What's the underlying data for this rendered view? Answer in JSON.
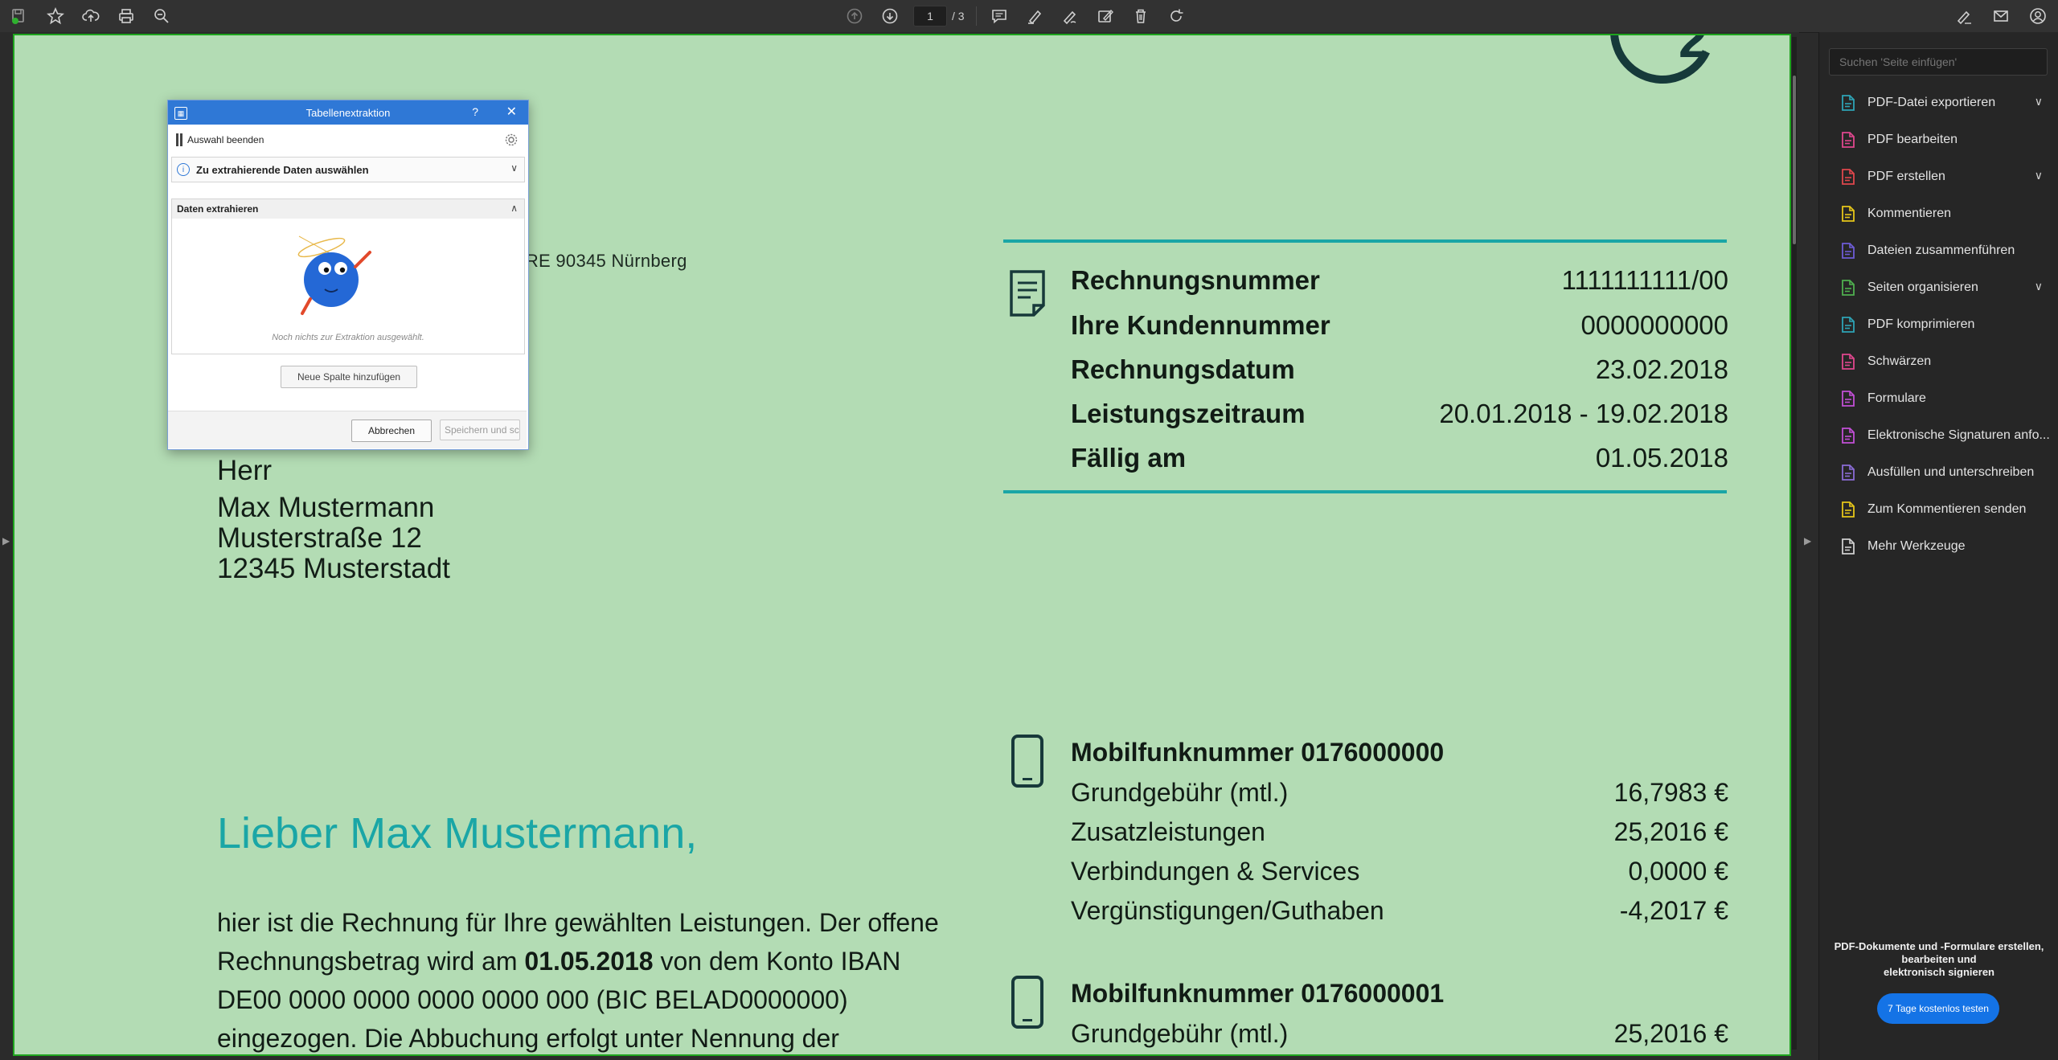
{
  "toolbar": {
    "page_current": "1",
    "page_total": "/ 3"
  },
  "document": {
    "logo_fragment": "2",
    "sender_line": "G  RE  90345 Nürnberg",
    "address": [
      "Herr",
      "Max Mustermann",
      "Musterstraße 12",
      "12345 Musterstadt"
    ],
    "info_rows": [
      {
        "key": "Rechnungsnummer",
        "value": "1111111111/00"
      },
      {
        "key": "Ihre Kundennummer",
        "value": "0000000000"
      },
      {
        "key": "Rechnungsdatum",
        "value": "23.02.2018"
      },
      {
        "key": "Leistungszeitraum",
        "value": "20.01.2018 - 19.02.2018"
      },
      {
        "key": "Fällig am",
        "value": "01.05.2018"
      }
    ],
    "mobile1": {
      "heading": "Mobilfunknummer 0176000000",
      "rows": [
        {
          "key": "Grundgebühr (mtl.)",
          "value": "16,7983 €"
        },
        {
          "key": "Zusatzleistungen",
          "value": "25,2016 €"
        },
        {
          "key": "Verbindungen & Services",
          "value": "0,0000 €"
        },
        {
          "key": "Vergünstigungen/Guthaben",
          "value": "-4,2017 €"
        }
      ]
    },
    "mobile2": {
      "heading": "Mobilfunknummer 0176000001",
      "rows": [
        {
          "key": "Grundgebühr (mtl.)",
          "value": "25,2016 €"
        }
      ]
    },
    "greeting": "Lieber Max Mustermann,",
    "body": {
      "line1": "hier ist die Rechnung für Ihre gewählten Leistungen. Der offene",
      "line2_a": "Rechnungsbetrag wird am ",
      "line2_b": "01.05.2018",
      "line2_c": " von dem Konto IBAN",
      "line3": "DE00 0000 0000 0000 0000 000 (BIC BELAD0000000)",
      "line4": "eingezogen. Die Abbuchung erfolgt unter Nennung der"
    }
  },
  "dialog": {
    "title": "Tabellenextraktion",
    "help": "?",
    "close": "✕",
    "stop_selection": "Auswahl beenden",
    "select_data": "Zu extrahierende Daten auswählen",
    "extract_header": "Daten extrahieren",
    "empty_message": "Noch nichts zur Extraktion ausgewählt.",
    "add_column": "Neue Spalte hinzufügen",
    "cancel": "Abbrechen",
    "save": "Speichern und sc"
  },
  "right_pane": {
    "search_placeholder": "Suchen 'Seite einfügen'",
    "tools": [
      {
        "label": "PDF-Datei exportieren",
        "icon": "export-pdf-icon",
        "color": "#2ea4b6",
        "expand": true
      },
      {
        "label": "PDF bearbeiten",
        "icon": "edit-pdf-icon",
        "color": "#e0478e",
        "expand": false
      },
      {
        "label": "PDF erstellen",
        "icon": "create-pdf-icon",
        "color": "#e0474c",
        "expand": true
      },
      {
        "label": "Kommentieren",
        "icon": "comment-icon",
        "color": "#e6c619",
        "expand": false
      },
      {
        "label": "Dateien zusammenführen",
        "icon": "combine-files-icon",
        "color": "#6d5cd6",
        "expand": false
      },
      {
        "label": "Seiten organisieren",
        "icon": "organize-pages-icon",
        "color": "#4fb04f",
        "expand": true
      },
      {
        "label": "PDF komprimieren",
        "icon": "compress-pdf-icon",
        "color": "#2ea4b6",
        "expand": false
      },
      {
        "label": "Schwärzen",
        "icon": "redact-icon",
        "color": "#e0478e",
        "expand": false
      },
      {
        "label": "Formulare",
        "icon": "forms-icon",
        "color": "#c24fd6",
        "expand": false
      },
      {
        "label": "Elektronische Signaturen anfo...",
        "icon": "request-signature-icon",
        "color": "#c24fd6",
        "expand": false
      },
      {
        "label": "Ausfüllen und unterschreiben",
        "icon": "fill-sign-icon",
        "color": "#8a6cd6",
        "expand": false
      },
      {
        "label": "Zum Kommentieren senden",
        "icon": "send-comment-icon",
        "color": "#e6c619",
        "expand": false
      },
      {
        "label": "Mehr Werkzeuge",
        "icon": "more-tools-icon",
        "color": "#cfcfcf",
        "expand": false
      }
    ],
    "promo_line1": "PDF-Dokumente und -Formulare erstellen,",
    "promo_line2": "bearbeiten und",
    "promo_line3": "elektronisch signieren",
    "trial_button": "7 Tage kostenlos testen"
  }
}
